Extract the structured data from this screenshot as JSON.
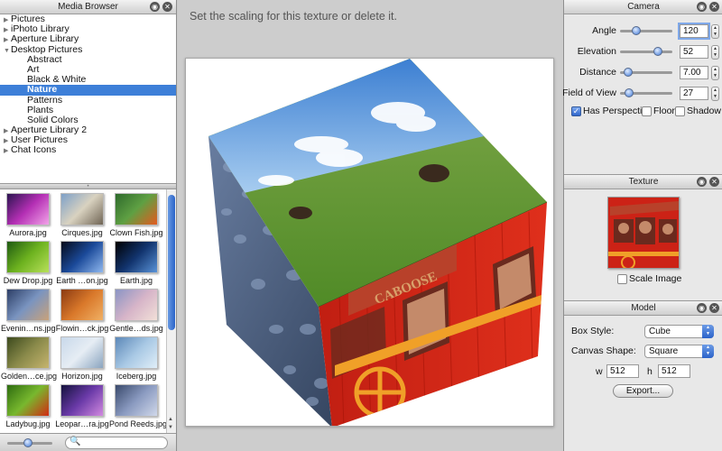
{
  "media_browser": {
    "title": "Media Browser",
    "tree": [
      {
        "label": "Pictures",
        "level": 0,
        "arrow": "▶"
      },
      {
        "label": "iPhoto Library",
        "level": 0,
        "arrow": "▶"
      },
      {
        "label": "Aperture Library",
        "level": 0,
        "arrow": "▶"
      },
      {
        "label": "Desktop Pictures",
        "level": 0,
        "arrow": "▼"
      },
      {
        "label": "Abstract",
        "level": 2
      },
      {
        "label": "Art",
        "level": 2
      },
      {
        "label": "Black & White",
        "level": 2
      },
      {
        "label": "Nature",
        "level": 2,
        "selected": true
      },
      {
        "label": "Patterns",
        "level": 2
      },
      {
        "label": "Plants",
        "level": 2
      },
      {
        "label": "Solid Colors",
        "level": 2
      },
      {
        "label": "Aperture Library 2",
        "level": 0,
        "arrow": "▶"
      },
      {
        "label": "User Pictures",
        "level": 0,
        "arrow": "▶"
      },
      {
        "label": "Chat Icons",
        "level": 0,
        "arrow": "▶"
      }
    ],
    "thumbnails": [
      {
        "name": "Aurora.jpg",
        "colors": [
          "#2b1450",
          "#b42fb4",
          "#f2a3e8"
        ]
      },
      {
        "name": "Cirques.jpg",
        "colors": [
          "#7da0c8",
          "#d9d2c0",
          "#6f6454"
        ]
      },
      {
        "name": "Clown Fish.jpg",
        "colors": [
          "#2e6a2c",
          "#5fa043",
          "#e45a1e"
        ]
      },
      {
        "name": "Dew Drop.jpg",
        "colors": [
          "#1e5a12",
          "#6db21f",
          "#b8e05a"
        ]
      },
      {
        "name": "Earth …on.jpg",
        "colors": [
          "#050a18",
          "#1b4a9a",
          "#8fb8ef"
        ]
      },
      {
        "name": "Earth.jpg",
        "colors": [
          "#000000",
          "#12346e",
          "#5a93d8"
        ]
      },
      {
        "name": "Evenin…ns.jpg",
        "colors": [
          "#2c3e66",
          "#7a94c0",
          "#c9a27a"
        ]
      },
      {
        "name": "Flowin…ck.jpg",
        "colors": [
          "#8a3a12",
          "#d9782a",
          "#f0b064"
        ]
      },
      {
        "name": "Gentle…ds.jpg",
        "colors": [
          "#8a94c4",
          "#d6b4c8",
          "#f2e0d8"
        ]
      },
      {
        "name": "Golden…ce.jpg",
        "colors": [
          "#3c4a1e",
          "#8a8a4a",
          "#c6b46e"
        ]
      },
      {
        "name": "Horizon.jpg",
        "colors": [
          "#c8d8ea",
          "#e6edf4",
          "#8aa4bf"
        ]
      },
      {
        "name": "Iceberg.jpg",
        "colors": [
          "#5c88b8",
          "#a8c8e4",
          "#e0eef8"
        ]
      },
      {
        "name": "Ladybug.jpg",
        "colors": [
          "#2e6c10",
          "#78b82e",
          "#d22a12"
        ]
      },
      {
        "name": "Leopar…ra.jpg",
        "colors": [
          "#14123c",
          "#6a3aa8",
          "#d28ae0"
        ]
      },
      {
        "name": "Pond Reeds.jpg",
        "colors": [
          "#3a4a6c",
          "#8a9ac0",
          "#d0d8ea"
        ]
      }
    ],
    "search_placeholder": "🔍"
  },
  "center": {
    "hint": "Set the scaling for this texture or delete it."
  },
  "camera": {
    "title": "Camera",
    "params": [
      {
        "label": "Angle",
        "value": "120",
        "level": 0.28,
        "focused": true
      },
      {
        "label": "Elevation",
        "value": "52",
        "level": 0.78
      },
      {
        "label": "Distance",
        "value": "7.00",
        "level": 0.08
      },
      {
        "label": "Field of View",
        "value": "27",
        "level": 0.1
      }
    ],
    "checkboxes": [
      {
        "label": "Has Perspective",
        "checked": true
      },
      {
        "label": "Floor",
        "checked": false
      },
      {
        "label": "Shadow",
        "checked": false
      }
    ]
  },
  "texture": {
    "title": "Texture",
    "scale_label": "Scale Image",
    "scale_checked": false
  },
  "model": {
    "title": "Model",
    "box_style_label": "Box Style:",
    "box_style_value": "Cube",
    "canvas_shape_label": "Canvas Shape:",
    "canvas_shape_value": "Square",
    "w_label": "w",
    "w_value": "512",
    "h_label": "h",
    "h_value": "512",
    "export_label": "Export..."
  },
  "cube_texts": {
    "caboose": "CABOOSE"
  }
}
